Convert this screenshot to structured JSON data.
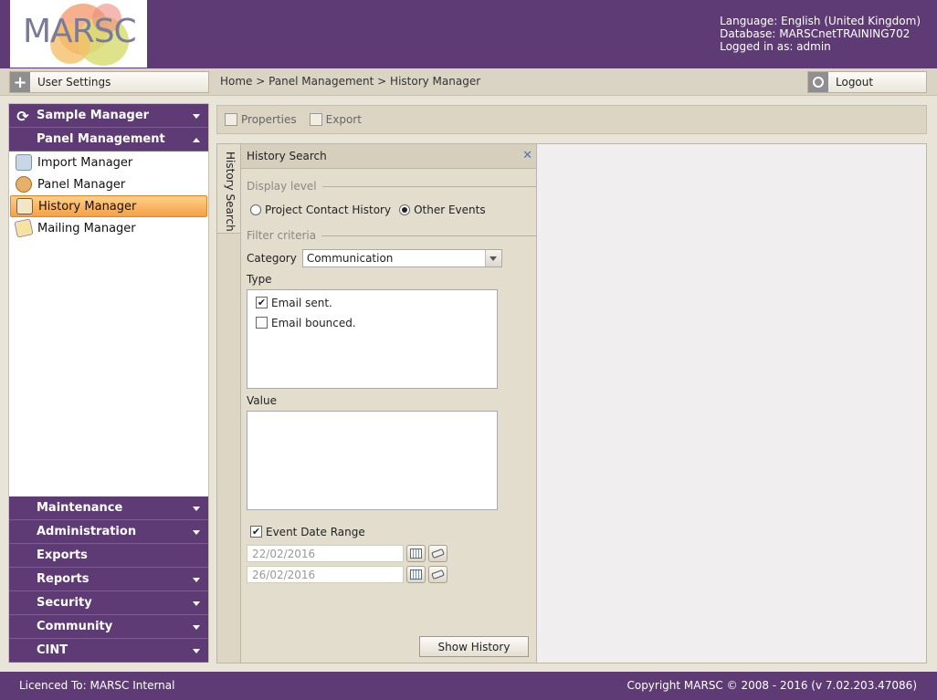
{
  "header": {
    "logo_text": "MARSC",
    "language": "Language: English (United Kingdom)",
    "database": "Database: MARSCnetTRAINING702",
    "logged_in": "Logged in as: admin"
  },
  "toolbar": {
    "user_settings_label": "User Settings",
    "breadcrumb": "Home > Panel Management > History Manager",
    "logout_label": "Logout"
  },
  "sidebar": {
    "sample_manager": "Sample Manager",
    "panel_management": "Panel Management",
    "items": [
      {
        "label": "Import Manager"
      },
      {
        "label": "Panel Manager"
      },
      {
        "label": "History Manager"
      },
      {
        "label": "Mailing Manager"
      }
    ],
    "bottom": [
      {
        "label": "Maintenance"
      },
      {
        "label": "Administration"
      },
      {
        "label": "Exports"
      },
      {
        "label": "Reports"
      },
      {
        "label": "Security"
      },
      {
        "label": "Community"
      },
      {
        "label": "CINT"
      }
    ]
  },
  "content_toolbar": {
    "properties": "Properties",
    "export": "Export"
  },
  "history_search": {
    "vertical_tab": "History Search",
    "title": "History Search",
    "display_level_label": "Display level",
    "radio_project": "Project Contact History",
    "radio_other": "Other Events",
    "filter_label": "Filter criteria",
    "category_label": "Category",
    "category_value": "Communication",
    "type_label": "Type",
    "type_items": [
      {
        "label": "Email sent.",
        "checked": true
      },
      {
        "label": "Email bounced.",
        "checked": false
      }
    ],
    "value_label": "Value",
    "date_range_label": "Event Date Range",
    "date_from": "22/02/2016",
    "date_to": "26/02/2016",
    "show_button": "Show History"
  },
  "footer": {
    "licence": "Licenced To: MARSC Internal",
    "copyright": "Copyright MARSC © 2008 - 2016  (v 7.02.203.47086)"
  },
  "colors": {
    "brand_purple": "#5e3b74",
    "active_orange": "#f5a044",
    "panel_beige": "#e3ddcd"
  }
}
